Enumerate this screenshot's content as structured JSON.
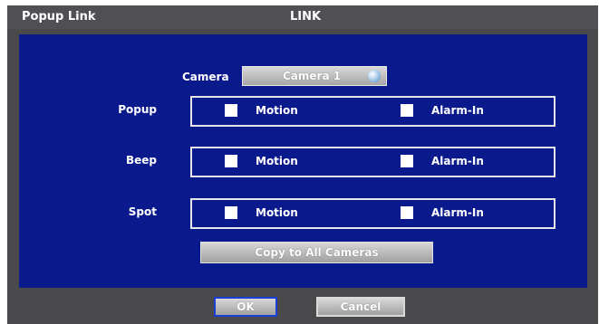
{
  "window": {
    "title_left": "Popup Link",
    "title_center": "LINK"
  },
  "camera": {
    "label": "Camera",
    "selected": "Camera 1"
  },
  "rows": [
    {
      "label": "Popup",
      "motion_label": "Motion",
      "motion_checked": false,
      "alarm_label": "Alarm-In",
      "alarm_checked": false
    },
    {
      "label": "Beep",
      "motion_label": "Motion",
      "motion_checked": false,
      "alarm_label": "Alarm-In",
      "alarm_checked": false
    },
    {
      "label": "Spot",
      "motion_label": "Motion",
      "motion_checked": false,
      "alarm_label": "Alarm-In",
      "alarm_checked": false
    }
  ],
  "copy_button_label": "Copy to All Cameras",
  "buttons": {
    "ok": "OK",
    "cancel": "Cancel"
  },
  "colors": {
    "panel_bg": "#0a1a8c",
    "frame_bg": "#4a4a4d",
    "ok_border": "#1a3fd6"
  }
}
